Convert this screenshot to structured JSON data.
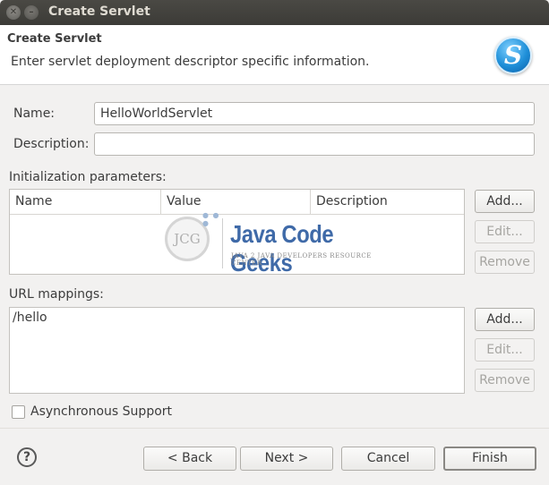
{
  "window": {
    "title": "Create Servlet"
  },
  "header": {
    "title": "Create Servlet",
    "description": "Enter servlet deployment descriptor specific information.",
    "logo_icon": "servlet-s-icon"
  },
  "form": {
    "name_label": "Name:",
    "name_value": "HelloWorldServlet",
    "description_label": "Description:",
    "description_value": ""
  },
  "init_params": {
    "label": "Initialization parameters:",
    "columns": [
      "Name",
      "Value",
      "Description"
    ],
    "rows": [],
    "buttons": {
      "add": "Add...",
      "edit": "Edit...",
      "remove": "Remove"
    }
  },
  "url_mappings": {
    "label": "URL mappings:",
    "items": [
      "/hello"
    ],
    "buttons": {
      "add": "Add...",
      "edit": "Edit...",
      "remove": "Remove"
    }
  },
  "async_support": {
    "label": "Asynchronous Support",
    "checked": false
  },
  "watermark": {
    "logo_text": "JCG",
    "title": "Java Code Geeks",
    "subtitle": "JAVA 2 JAVA DEVELOPERS RESOURCE CENTER"
  },
  "footer": {
    "help_icon": "help-icon",
    "back": "< Back",
    "next": "Next >",
    "cancel": "Cancel",
    "finish": "Finish"
  }
}
